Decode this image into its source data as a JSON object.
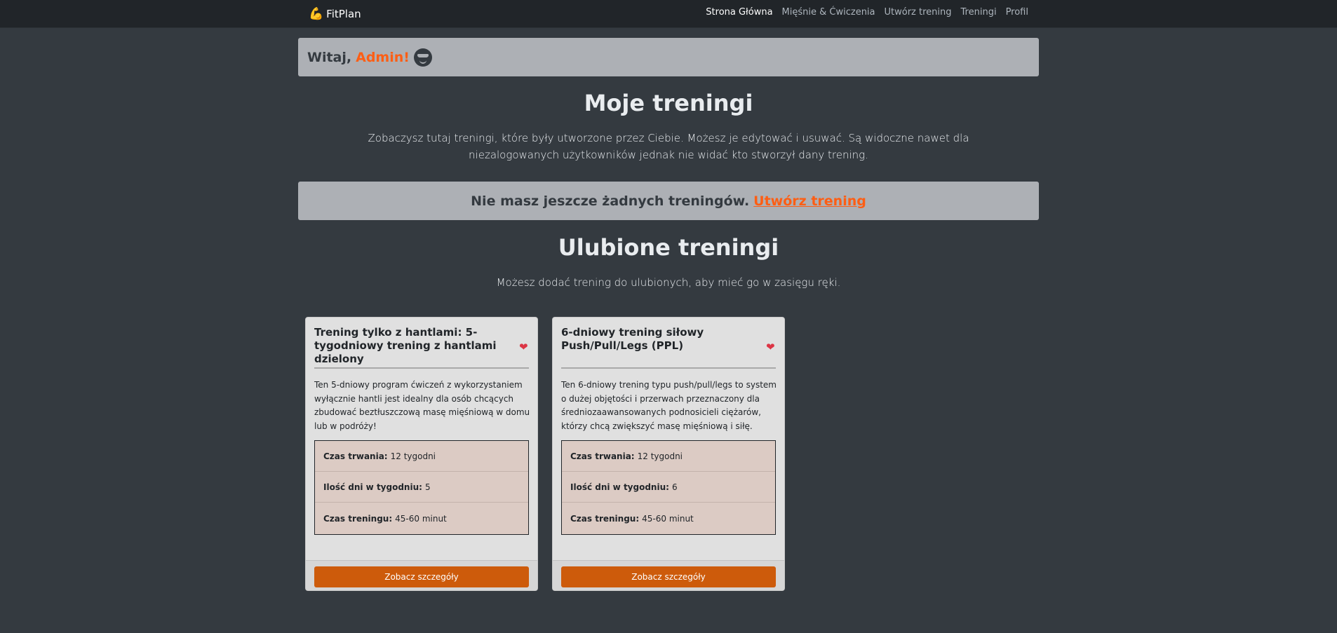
{
  "navbar": {
    "brand_icon": "flexed-biceps-icon",
    "brand": "FitPlan",
    "links": [
      {
        "label": "Strona Główna",
        "active": true
      },
      {
        "label": "Mięśnie & Ćwiczenia",
        "active": false
      },
      {
        "label": "Utwórz trening",
        "active": false
      },
      {
        "label": "Treningi",
        "active": false
      },
      {
        "label": "Profil",
        "active": false
      }
    ]
  },
  "welcome": {
    "greeting": "Witaj,",
    "name": "Admin!",
    "icon": "sunglasses-smiley-icon"
  },
  "my_trainings": {
    "title": "Moje treningi",
    "description": "Zobaczysz tutaj treningi, które były utworzone przez Ciebie. Możesz je edytować i usuwać. Są widoczne nawet dla niezalogowanych użytkowników jednak nie widać kto stworzył dany trening.",
    "empty_text": "Nie masz jeszcze żadnych treningów.",
    "create_link": "Utwórz trening"
  },
  "favorites": {
    "title": "Ulubione treningi",
    "description": "Możesz dodać trening do ulubionych, aby mieć go w zasięgu ręki.",
    "cards": [
      {
        "title": "Trening tylko z hantlami: 5-tygodniowy trening z hantlami dzielony",
        "description": "Ten 5-dniowy program ćwiczeń z wykorzystaniem wyłącznie hantli jest idealny dla osób chcących zbudować beztłuszczową masę mięśniową w domu lub w podróży!",
        "details": [
          {
            "label": "Czas trwania:",
            "value": "12 tygodni"
          },
          {
            "label": "Ilość dni w tygodniu:",
            "value": "5"
          },
          {
            "label": "Czas treningu:",
            "value": "45-60 minut"
          }
        ],
        "button": "Zobacz szczegóły"
      },
      {
        "title": "6-dniowy trening siłowy Push/Pull/Legs (PPL)",
        "description": "Ten 6-dniowy trening typu push/pull/legs to system o dużej objętości i przerwach przeznaczony dla średniozaawansowanych podnosicieli ciężarów, którzy chcą zwiększyć masę mięśniową i siłę.",
        "details": [
          {
            "label": "Czas trwania:",
            "value": "12 tygodni"
          },
          {
            "label": "Ilość dni w tygodniu:",
            "value": "6"
          },
          {
            "label": "Czas treningu:",
            "value": "45-60 minut"
          }
        ],
        "button": "Zobacz szczegóły"
      }
    ]
  },
  "colors": {
    "background": "#343a40",
    "navbar": "#212529",
    "accent": "#fd5e14",
    "button": "#cd5b0b",
    "heart": "#dc3545"
  }
}
